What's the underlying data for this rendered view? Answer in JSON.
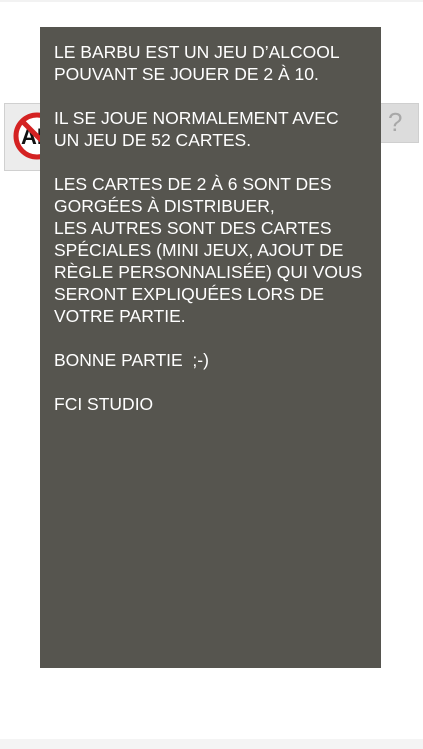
{
  "background": {
    "logo_text": "AL",
    "help_symbol": "?"
  },
  "info_panel": {
    "paragraphs": [
      [
        "LE BARBU EST UN JEU D’ALCOOL",
        "POUVANT SE JOUER DE 2 À 10."
      ],
      [
        "IL SE JOUE NORMALEMENT AVEC",
        "UN JEU DE 52 CARTES."
      ],
      [
        "LES CARTES DE 2 À 6 SONT DES",
        "GORGÉES À DISTRIBUER,",
        "LES AUTRES SONT DES CARTES",
        "SPÉCIALES (MINI JEUX, AJOUT DE",
        "RÈGLE PERSONNALISÉE) QUI VOUS",
        "SERONT EXPLIQUÉES LORS DE",
        "VOTRE PARTIE."
      ],
      [
        "BONNE PARTIE  ;-)"
      ],
      [
        "FCI STUDIO"
      ]
    ]
  },
  "colors": {
    "panel_bg": "#56554f",
    "panel_text": "#ffffff",
    "logo_red": "#d42222",
    "help_bg": "#dcdcdc"
  }
}
